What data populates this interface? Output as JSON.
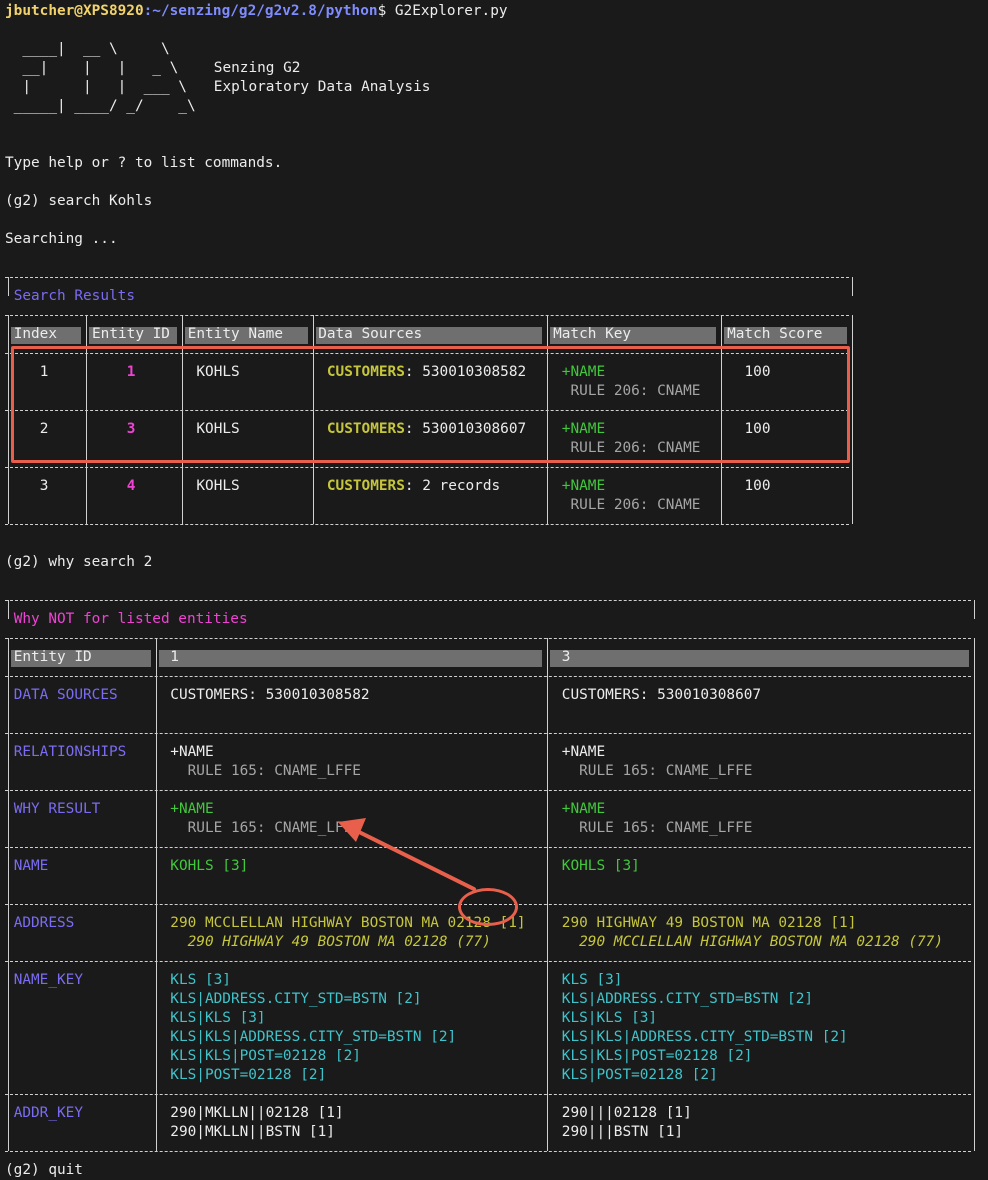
{
  "colors": {
    "background": "#1a1a1a",
    "text": "#ececec",
    "prompt_user": "#f2d36b",
    "prompt_path": "#7f8cff",
    "magenta": "#ef43d4",
    "purple": "#7a6cf2",
    "olive": "#c6c63d",
    "green": "#41c83b",
    "gray": "#a5a5a5",
    "cyan": "#3fc3c9",
    "annotation": "#e8604c"
  },
  "prompt": {
    "user_host": "jbutcher@XPS8920",
    "path": ":~/senzing/g2/g2v2.8/python",
    "command": "$ G2Explorer.py"
  },
  "banner": {
    "logo_lines": [
      "  ____|  __ \\     \\",
      "  __|    |   |   _ \\   ",
      "  |      |   |  ___ \\  ",
      " _____| ____/ _/    _\\"
    ],
    "product_line1": "Senzing G2",
    "product_line2": "Exploratory Data Analysis"
  },
  "session": {
    "help_text": "Type help or ? to list commands.",
    "command1": "(g2) search Kohls",
    "searching": "Searching ...",
    "command2": "(g2) why search 2",
    "command3": "(g2) quit"
  },
  "search_results": {
    "title": "Search Results",
    "headers": [
      "Index",
      "Entity ID",
      "Entity Name",
      "Data Sources",
      "Match Key",
      "Match Score"
    ],
    "rows": [
      {
        "index": "1",
        "entity_id": "1",
        "entity_name": "KOHLS",
        "source": "CUSTOMERS",
        "source_value": ": 530010308582",
        "match_key": "+NAME",
        "rule": "RULE 206: CNAME",
        "score": "100"
      },
      {
        "index": "2",
        "entity_id": "3",
        "entity_name": "KOHLS",
        "source": "CUSTOMERS",
        "source_value": ": 530010308607",
        "match_key": "+NAME",
        "rule": "RULE 206: CNAME",
        "score": "100"
      },
      {
        "index": "3",
        "entity_id": "4",
        "entity_name": "KOHLS",
        "source": "CUSTOMERS",
        "source_value": ": 2 records",
        "match_key": "+NAME",
        "rule": "RULE 206: CNAME",
        "score": "100"
      }
    ]
  },
  "why_not": {
    "title": "Why NOT for listed entities",
    "header_label": "Entity ID",
    "entity_a": "1",
    "entity_b": "3",
    "rows": [
      {
        "label": "DATA SOURCES",
        "a": [
          "CUSTOMERS: 530010308582"
        ],
        "b": [
          "CUSTOMERS: 530010308607"
        ]
      },
      {
        "label": "RELATIONSHIPS",
        "a": [
          "+NAME",
          "  RULE 165: CNAME_LFFE"
        ],
        "b": [
          "+NAME",
          "  RULE 165: CNAME_LFFE"
        ]
      },
      {
        "label": "WHY RESULT",
        "a": [
          "+NAME",
          "  RULE 165: CNAME_LFFE"
        ],
        "b": [
          "+NAME",
          "  RULE 165: CNAME_LFFE"
        ]
      },
      {
        "label": "NAME",
        "a": [
          "KOHLS [3]"
        ],
        "b": [
          "KOHLS [3]"
        ]
      },
      {
        "label": "ADDRESS",
        "a": [
          "290 MCCLELLAN HIGHWAY BOSTON MA 02128 [1]",
          "  290 HIGHWAY 49 BOSTON MA 02128 (77)"
        ],
        "b": [
          "290 HIGHWAY 49 BOSTON MA 02128 [1]",
          "  290 MCCLELLAN HIGHWAY BOSTON MA 02128 (77)"
        ]
      },
      {
        "label": "NAME_KEY",
        "a": [
          "KLS [3]",
          "KLS|ADDRESS.CITY_STD=BSTN [2]",
          "KLS|KLS [3]",
          "KLS|KLS|ADDRESS.CITY_STD=BSTN [2]",
          "KLS|KLS|POST=02128 [2]",
          "KLS|POST=02128 [2]"
        ],
        "b": [
          "KLS [3]",
          "KLS|ADDRESS.CITY_STD=BSTN [2]",
          "KLS|KLS [3]",
          "KLS|KLS|ADDRESS.CITY_STD=BSTN [2]",
          "KLS|KLS|POST=02128 [2]",
          "KLS|POST=02128 [2]"
        ]
      },
      {
        "label": "ADDR_KEY",
        "a": [
          "290|MKLLN||02128 [1]",
          "290|MKLLN||BSTN [1]"
        ],
        "b": [
          "290|||02128 [1]",
          "290|||BSTN [1]"
        ]
      }
    ]
  }
}
